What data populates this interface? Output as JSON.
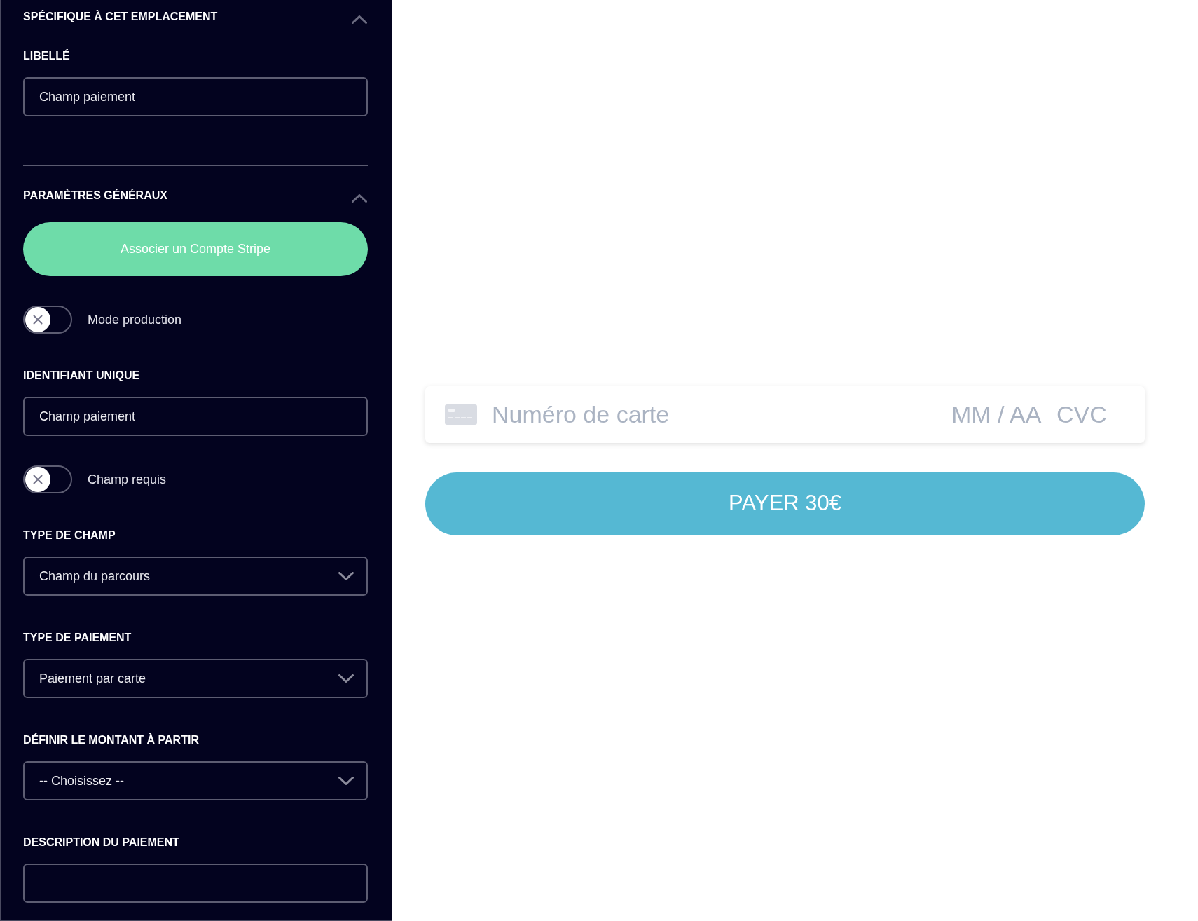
{
  "sidebar": {
    "sections": [
      {
        "title": "SPÉCIFIQUE À CET EMPLACEMENT",
        "expanded": true,
        "items": [
          {
            "kind": "text",
            "label": "LIBELLÉ",
            "value": "Champ paiement"
          }
        ]
      },
      {
        "title": "PARAMÈTRES GÉNÉRAUX",
        "expanded": true,
        "items": [
          {
            "kind": "button",
            "label": "Associer un Compte Stripe"
          },
          {
            "kind": "toggle",
            "label": "Mode production",
            "on": false
          },
          {
            "kind": "text",
            "label": "IDENTIFIANT UNIQUE",
            "value": "Champ paiement"
          },
          {
            "kind": "toggle",
            "label": "Champ requis",
            "on": false
          },
          {
            "kind": "select",
            "label": "TYPE DE CHAMP",
            "value": "Champ du parcours"
          },
          {
            "kind": "select",
            "label": "TYPE DE PAIEMENT",
            "value": "Paiement par carte"
          },
          {
            "kind": "select",
            "label": "DÉFINIR LE MONTANT À PARTIR",
            "value": "-- Choisissez --"
          },
          {
            "kind": "text",
            "label": "DESCRIPTION DU PAIEMENT"
          }
        ]
      }
    ]
  },
  "payment_form": {
    "card_field": {
      "number": {
        "placeholder": "Numéro de carte"
      },
      "expiry": {
        "placeholder": "MM / AA"
      },
      "cvc": {
        "placeholder": "CVC"
      }
    },
    "pay_button": "PAYER 30€"
  }
}
